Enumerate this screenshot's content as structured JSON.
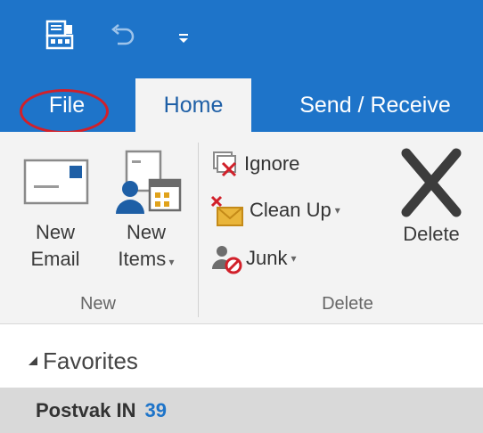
{
  "tabs": [
    {
      "label": "File"
    },
    {
      "label": "Home"
    },
    {
      "label": "Send / Receive"
    }
  ],
  "ribbon": {
    "new_group": {
      "new_email_line1": "New",
      "new_email_line2": "Email",
      "new_items_line1": "New",
      "new_items_line2": "Items",
      "group_label": "New"
    },
    "delete_group": {
      "ignore": "Ignore",
      "clean_up": "Clean Up",
      "junk": "Junk",
      "delete": "Delete",
      "group_label": "Delete"
    }
  },
  "folders": {
    "favorites_label": "Favorites",
    "postvak_label": "Postvak IN",
    "postvak_count": "39"
  },
  "colors": {
    "accent": "#1e74c9",
    "highlight": "#d1202a",
    "count": "#1e74c9"
  }
}
